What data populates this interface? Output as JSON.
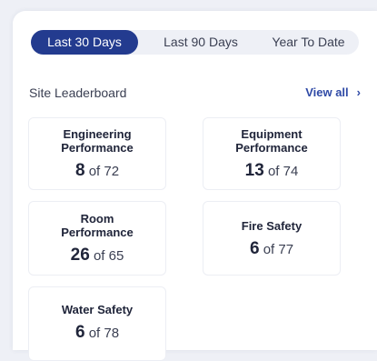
{
  "tabs": [
    {
      "label": "Last 30 Days",
      "active": true
    },
    {
      "label": "Last 90 Days",
      "active": false
    },
    {
      "label": "Year To Date",
      "active": false
    }
  ],
  "leaderboard": {
    "title": "Site Leaderboard",
    "view_all_label": "View all",
    "of_label": "of",
    "cards": [
      {
        "title_line1": "Engineering",
        "title_line2": "Performance",
        "rank": "8",
        "total": "72"
      },
      {
        "title_line1": "Equipment",
        "title_line2": "Performance",
        "rank": "13",
        "total": "74"
      },
      {
        "title_line1": "Room",
        "title_line2": "Performance",
        "rank": "26",
        "total": "65"
      },
      {
        "title_line1": "Fire Safety",
        "title_line2": "",
        "rank": "6",
        "total": "77"
      },
      {
        "title_line1": "Water Safety",
        "title_line2": "",
        "rank": "6",
        "total": "78"
      }
    ]
  },
  "colors": {
    "accent": "#233b8f",
    "link": "#2f4aa6",
    "background": "#eef0f6"
  }
}
